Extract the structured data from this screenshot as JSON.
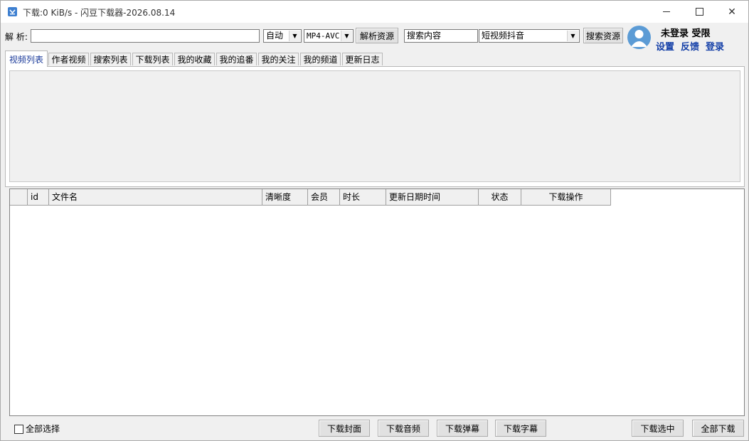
{
  "window": {
    "title": "下载:0 KiB/s - 闪豆下载器-2026.08.14",
    "minimize_glyph": "—",
    "close_glyph": "✕",
    "icon": "app-icon"
  },
  "toolbar": {
    "parse_label": "解 析:",
    "url_value": "",
    "mode_select": "自动",
    "format_select": "MP4-AVC",
    "parse_button": "解析资源",
    "search_value": "搜索内容",
    "platform_select": "短视频抖音",
    "search_button": "搜索资源"
  },
  "user": {
    "status": "未登录  受限",
    "settings": "设置",
    "feedback": "反馈",
    "login": "登录"
  },
  "tabs": [
    {
      "label": "视频列表"
    },
    {
      "label": "作者视频"
    },
    {
      "label": "搜索列表"
    },
    {
      "label": "下载列表"
    },
    {
      "label": "我的收藏"
    },
    {
      "label": "我的追番"
    },
    {
      "label": "我的关注"
    },
    {
      "label": "我的频道"
    },
    {
      "label": "更新日志"
    }
  ],
  "table": {
    "columns": [
      "",
      "id",
      "文件名",
      "清晰度",
      "会员",
      "时长",
      "更新日期时间",
      "状态",
      "下载操作"
    ],
    "rows": []
  },
  "footer": {
    "select_all": "全部选择",
    "download_cover": "下载封面",
    "download_audio": "下载音频",
    "download_danmaku": "下载弹幕",
    "download_subtitle": "下载字幕",
    "download_selected": "下载选中",
    "download_all": "全部下载"
  },
  "colors": {
    "accent_link": "#1540a8",
    "avatar": "#5b9bd5",
    "active_tab_text": "#1a3a9a"
  }
}
